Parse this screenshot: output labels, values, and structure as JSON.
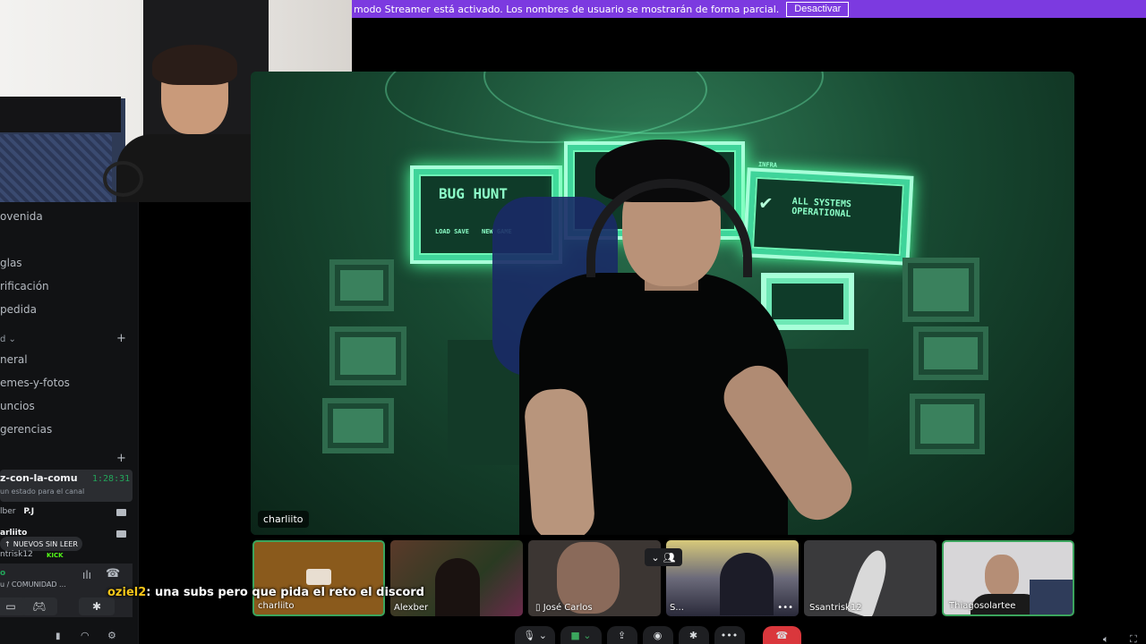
{
  "banner": {
    "message": "modo Streamer está activado. Los nombres de usuario se mostrarán de forma parcial.",
    "deactivate_label": "Desactivar"
  },
  "sidebar": {
    "channels_top": [
      "ovenida",
      "glas",
      "rificación",
      "pedida"
    ],
    "category": "d",
    "text_channels": [
      "neral",
      "emes-y-fotos",
      "uncios",
      "gerencias"
    ],
    "voice_channel": {
      "name": "z-con-la-comu",
      "timer": "1:28:31",
      "status": "un estado para el canal"
    },
    "voice_users": [
      "lber",
      "P.J",
      "arliito",
      "ntrisk12"
    ],
    "unread_label": "NUEVOS SIN LEER",
    "kick_label": "KICK",
    "panel": {
      "connected": "o",
      "subtitle": "u / COMUNIDAD ..."
    }
  },
  "stage": {
    "speaker_name": "charliito",
    "screens": {
      "left_title": "BUG HUNT",
      "left_buttons": [
        "LOAD SAVE",
        "NEW GAME"
      ],
      "right_label": "INFRA",
      "right_status": "ALL SYSTEMS OPERATIONAL"
    }
  },
  "participants": [
    {
      "name": "charliito",
      "color": "#8a5a1c",
      "selected": true
    },
    {
      "name": "Alexber",
      "color": "#4a3528",
      "selected": false
    },
    {
      "name": "José Carlos",
      "color": "#3c3633",
      "selected": false
    },
    {
      "name": "S...",
      "color": "#6b6a7a",
      "selected": false
    },
    {
      "name": "Ssantrisk12",
      "color": "#3a3a3c",
      "selected": false
    },
    {
      "name": "Thiagosolartee",
      "color": "#d7d6d8",
      "selected": true
    }
  ],
  "chat_overlay": {
    "user": "oziel2",
    "message": ": una subs pero que pida el reto el discord"
  },
  "colors": {
    "banner": "#7c3ae0",
    "accent_green": "#3ba55d",
    "danger": "#da373c"
  }
}
